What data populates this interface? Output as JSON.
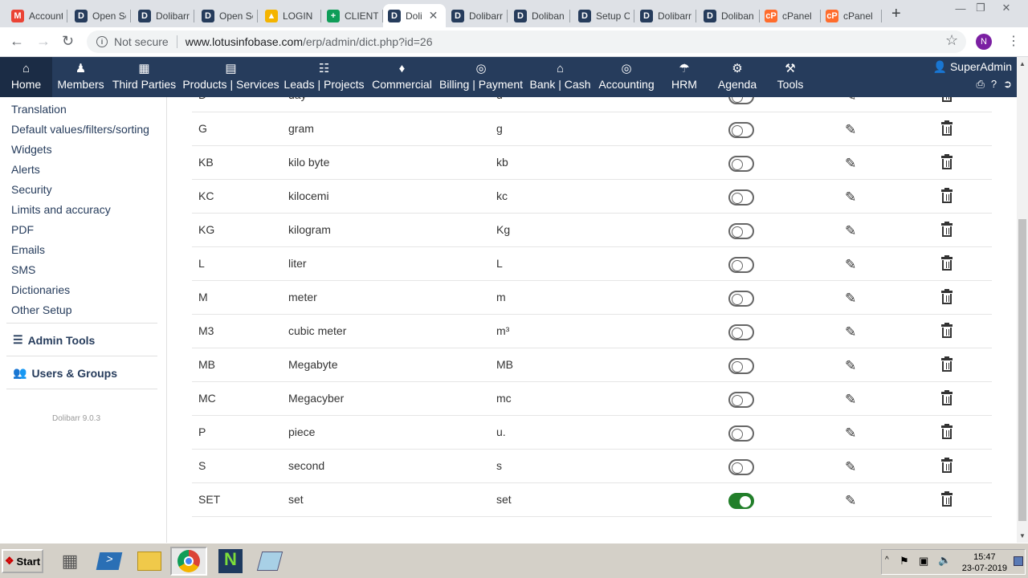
{
  "browser": {
    "tabs": [
      {
        "title": "Account",
        "favicon": "M",
        "color": "#ea4335"
      },
      {
        "title": "Open Sc",
        "favicon": "D",
        "color": "#263c5c"
      },
      {
        "title": "Dolibarr",
        "favicon": "D",
        "color": "#263c5c"
      },
      {
        "title": "Open Sc",
        "favicon": "D",
        "color": "#263c5c"
      },
      {
        "title": "LOGIN",
        "favicon": "▲",
        "color": "#f4b400"
      },
      {
        "title": "CLIENT",
        "favicon": "+",
        "color": "#0f9d58"
      },
      {
        "title": "Doli",
        "favicon": "D",
        "color": "#263c5c",
        "active": true
      },
      {
        "title": "Dolibarr",
        "favicon": "D",
        "color": "#263c5c"
      },
      {
        "title": "Doliban",
        "favicon": "D",
        "color": "#263c5c"
      },
      {
        "title": "Setup C",
        "favicon": "D",
        "color": "#263c5c"
      },
      {
        "title": "Dolibarr",
        "favicon": "D",
        "color": "#263c5c"
      },
      {
        "title": "Doliban",
        "favicon": "D",
        "color": "#263c5c"
      },
      {
        "title": "cPanel",
        "favicon": "cP",
        "color": "#ff6c2c"
      },
      {
        "title": "cPanel",
        "favicon": "cP",
        "color": "#ff6c2c"
      }
    ],
    "new_tab": "+",
    "not_secure": "Not secure",
    "url_host": "www.lotusinfobase.com",
    "url_path": "/erp/admin/dict.php?id=26",
    "profile_initial": "N"
  },
  "topmenu": {
    "items": [
      {
        "label": "Home",
        "icon": "home-icon"
      },
      {
        "label": "Members",
        "icon": "members-icon"
      },
      {
        "label": "Third Parties",
        "icon": "building-icon"
      },
      {
        "label": "Products | Services",
        "icon": "cube-icon"
      },
      {
        "label": "Leads | Projects",
        "icon": "sitemap-icon"
      },
      {
        "label": "Commercial",
        "icon": "tie-icon"
      },
      {
        "label": "Billing | Payment",
        "icon": "coins-icon"
      },
      {
        "label": "Bank | Cash",
        "icon": "bank-icon"
      },
      {
        "label": "Accounting",
        "icon": "money-icon"
      },
      {
        "label": "HRM",
        "icon": "umbrella-icon"
      },
      {
        "label": "Agenda",
        "icon": "cog-icon"
      },
      {
        "label": "Tools",
        "icon": "tools-icon"
      }
    ],
    "user": "SuperAdmin"
  },
  "sidebar": {
    "links": [
      "Translation",
      "Default values/filters/sorting",
      "Widgets",
      "Alerts",
      "Security",
      "Limits and accuracy",
      "PDF",
      "Emails",
      "SMS",
      "Dictionaries",
      "Other Setup"
    ],
    "admin_tools": "Admin Tools",
    "users_groups": "Users & Groups",
    "version": "Dolibarr 9.0.3"
  },
  "table": {
    "partial_row": {
      "code": "D",
      "label": "day",
      "short": "d"
    },
    "rows": [
      {
        "code": "G",
        "label": "gram",
        "short": "g",
        "active": false
      },
      {
        "code": "KB",
        "label": "kilo byte",
        "short": "kb",
        "active": false
      },
      {
        "code": "KC",
        "label": "kilocemi",
        "short": "kc",
        "active": false
      },
      {
        "code": "KG",
        "label": "kilogram",
        "short": "Kg",
        "active": false
      },
      {
        "code": "L",
        "label": "liter",
        "short": "L",
        "active": false
      },
      {
        "code": "M",
        "label": "meter",
        "short": "m",
        "active": false
      },
      {
        "code": "M3",
        "label": "cubic meter",
        "short": "m³",
        "active": false
      },
      {
        "code": "MB",
        "label": "Megabyte",
        "short": "MB",
        "active": false
      },
      {
        "code": "MC",
        "label": "Megacyber",
        "short": "mc",
        "active": false
      },
      {
        "code": "P",
        "label": "piece",
        "short": "u.",
        "active": false
      },
      {
        "code": "S",
        "label": "second",
        "short": "s",
        "active": false
      },
      {
        "code": "SET",
        "label": "set",
        "short": "set",
        "active": true
      }
    ]
  },
  "taskbar": {
    "start": "Start",
    "time": "15:47",
    "date": "23-07-2019"
  },
  "colors": {
    "menu_bg": "#263c5c",
    "toggle_on": "#227f2a"
  }
}
